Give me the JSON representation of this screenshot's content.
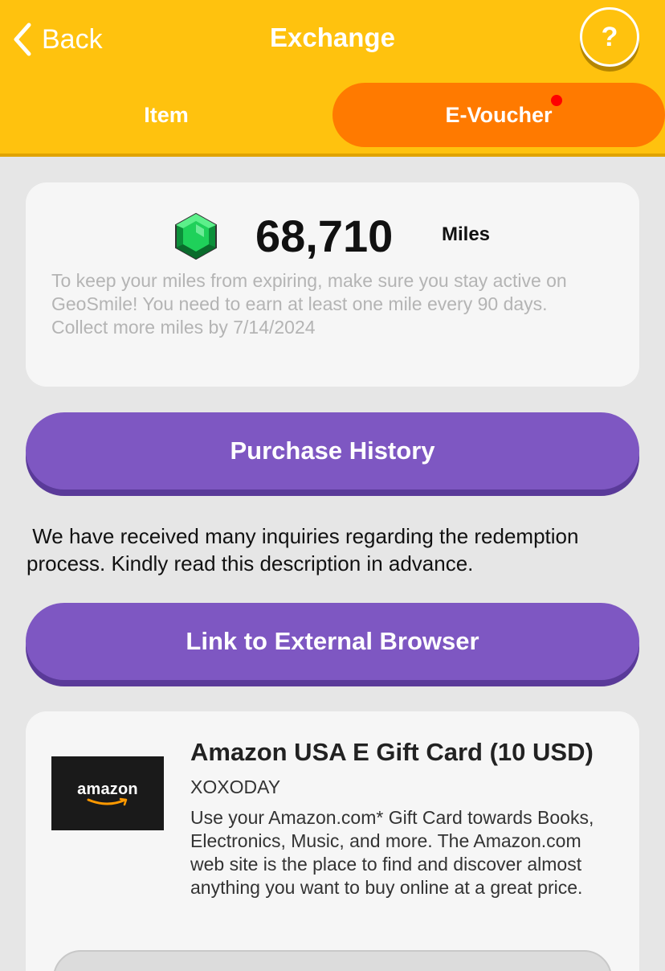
{
  "header": {
    "back_label": "Back",
    "title": "Exchange",
    "help_label": "?"
  },
  "tabs": [
    {
      "label": "Item",
      "active": false
    },
    {
      "label": "E-Voucher",
      "active": true,
      "has_notification": true
    }
  ],
  "miles": {
    "icon": "green-gem-icon",
    "value": "68,710",
    "unit": "Miles",
    "note": "To keep your miles from expiring, make sure you stay active on GeoSmile! You need to earn at least one mile every 90 days.\nCollect more miles by 7/14/2024"
  },
  "buttons": {
    "purchase_history": "Purchase History",
    "external_link": "Link to External Browser"
  },
  "inquiry_text": " We have received many inquiries regarding the redemption process. Kindly read this description in advance.",
  "product": {
    "logo_text": "amazon",
    "title": "Amazon USA E Gift Card (10 USD)",
    "provider": "XOXODAY",
    "description": "Use your Amazon.com* Gift Card towards Books, Electronics, Music, and more. The Amazon.com web site is the place to find and discover almost anything you want to buy online at a great price."
  },
  "colors": {
    "header_yellow": "#ffc20e",
    "active_tab_orange": "#ff7a00",
    "button_purple": "#7e57c2",
    "notification_red": "#ff0000"
  }
}
